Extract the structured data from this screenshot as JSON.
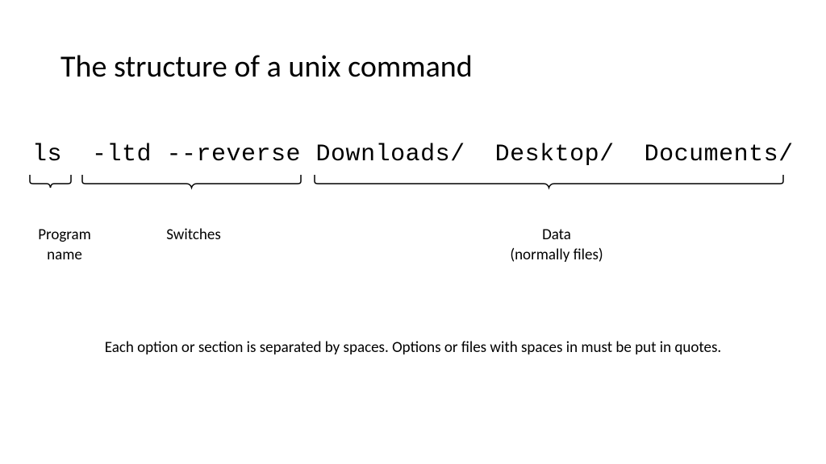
{
  "title": "The structure of a unix command",
  "command": "ls  -ltd --reverse Downloads/  Desktop/  Documents/",
  "labels": {
    "program": "Program name",
    "switches": "Switches",
    "data": "Data\n(normally files)"
  },
  "footnote": "Each option or section is separated by spaces.  Options or files with spaces in must be put in quotes."
}
